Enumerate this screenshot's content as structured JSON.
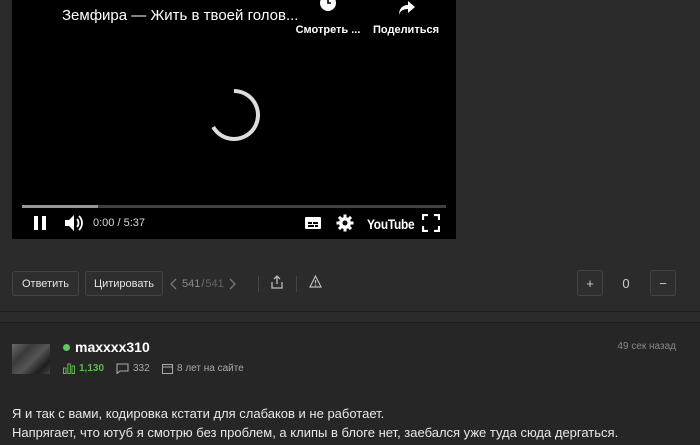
{
  "video": {
    "title": "Земфира — Жить в твоей голов...",
    "watch_later_label": "Смотреть ...",
    "share_label": "Поделиться",
    "time": "0:00 / 5:37",
    "buffered_fraction": 0.18,
    "logo": "YouTube"
  },
  "toolbar": {
    "reply_label": "Ответить",
    "quote_label": "Цитировать",
    "page_current": "541",
    "page_sep": "/",
    "page_total": "541",
    "score": "0",
    "plus_label": "+",
    "minus_label": "−"
  },
  "comment": {
    "username": "maxxxx310",
    "time_ago": "49 сек назад",
    "rating": "1,130",
    "comments_count": "332",
    "on_site": "8 лет на сайте",
    "text_line1": "Я и так с вами, кодировка кстати для слабаков и не работает.",
    "text_line2": "Напрягает, что ютуб я смотрю без проблем, а клипы в блоге нет, заебался уже туда сюда дергаться.",
    "online_color": "#66c55a",
    "rating_color": "#5fb94e"
  },
  "icons": [
    "clock-icon",
    "share-arrow-icon",
    "loading-spinner-icon",
    "pause-icon",
    "volume-icon",
    "subtitles-icon",
    "settings-gear-icon",
    "fullscreen-icon",
    "chevron-left-icon",
    "chevron-right-icon",
    "upload-share-icon",
    "warning-icon",
    "rating-bars-icon",
    "comment-bubble-icon",
    "calendar-icon"
  ]
}
